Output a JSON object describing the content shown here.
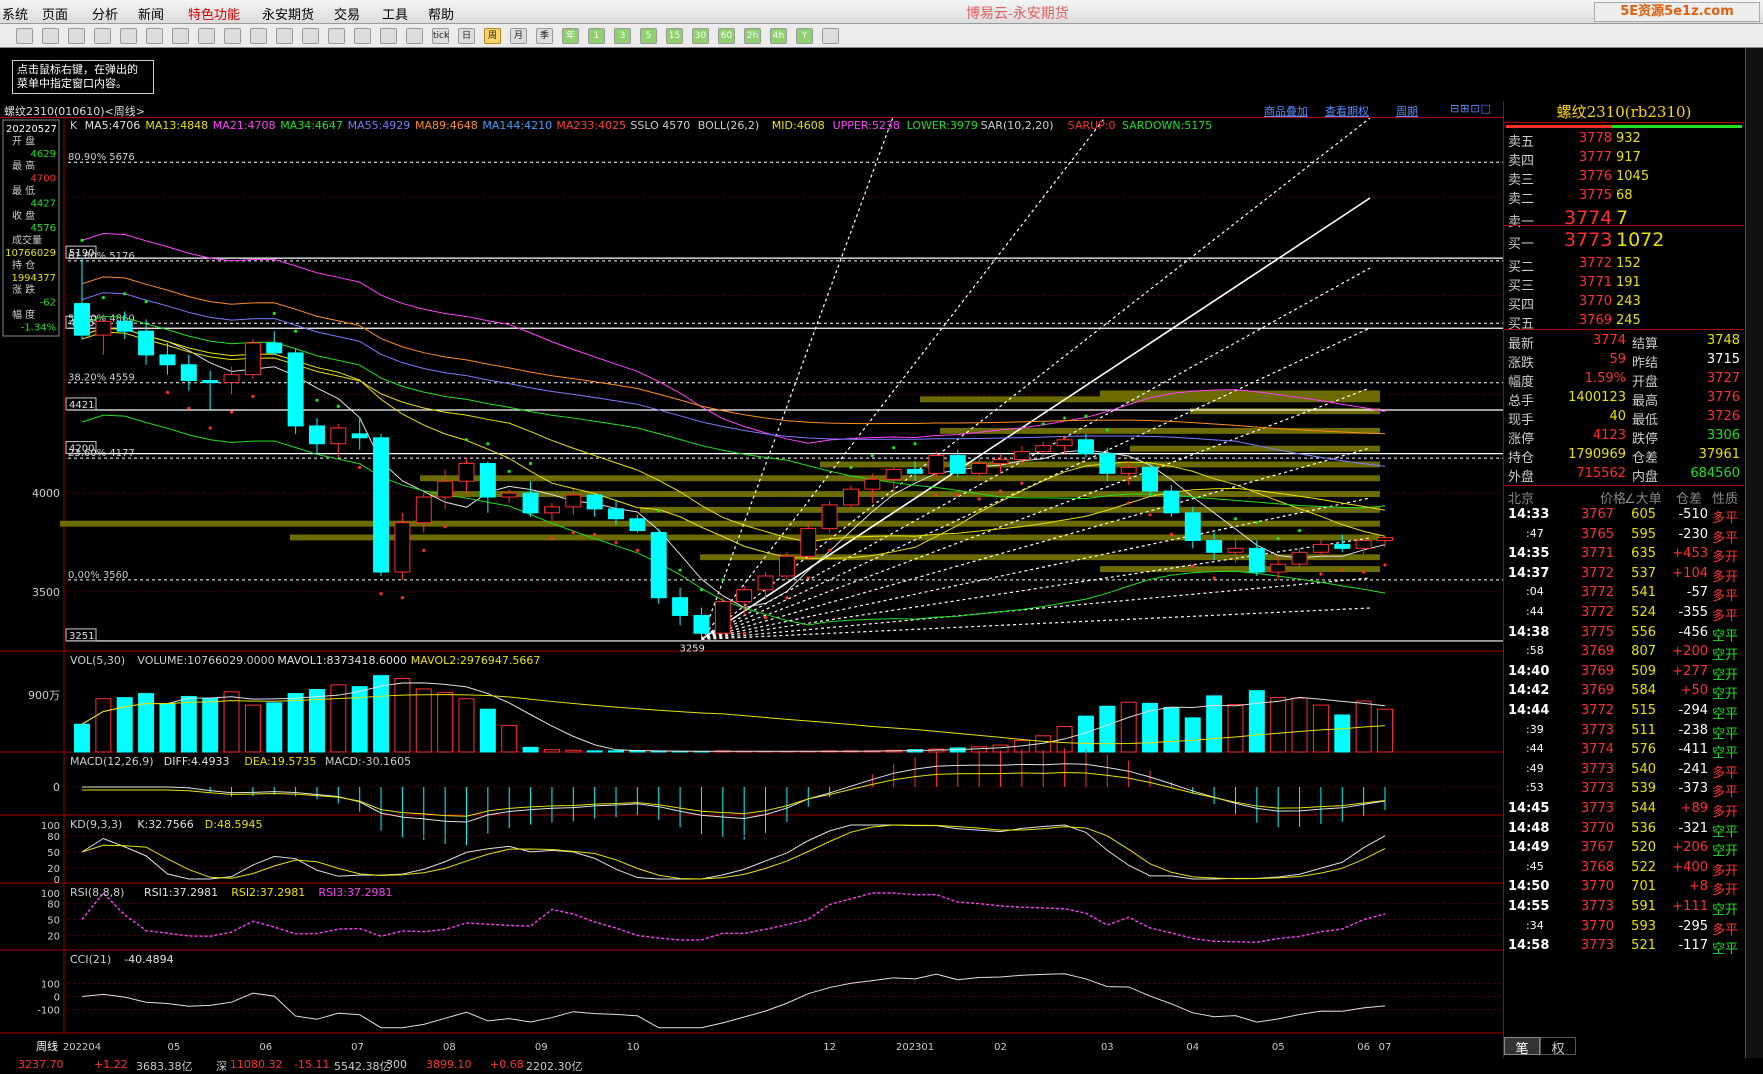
{
  "menu": [
    "系统",
    "页面",
    "分析",
    "新闻",
    "特色功能",
    "永安期货",
    "交易",
    "工具",
    "帮助"
  ],
  "app_title": "博易云-永安期货",
  "brand_text": "5E资源5e1z.com",
  "toolbar_tips": [
    "",
    "",
    "",
    "",
    "",
    "",
    "",
    "",
    "",
    "",
    "",
    "",
    "",
    "",
    "",
    "",
    "tick",
    "日",
    "周",
    "月",
    "季",
    "年",
    "1",
    "3",
    "5",
    "15",
    "30",
    "60",
    "2h",
    "4h",
    "Y",
    ""
  ],
  "hint": [
    "点击鼠标右键，在弹出的",
    "菜单中指定窗口内容。"
  ],
  "chart_header": {
    "symbol": "螺纹2310(010610)<周线>",
    "links": [
      "商品叠加",
      "查看期权",
      "周期"
    ]
  },
  "indicator_line": [
    {
      "t": "K",
      "c": "#cccccc"
    },
    {
      "t": "MA5:4706",
      "c": "#e0e0e0"
    },
    {
      "t": "MA13:4848",
      "c": "#e8e000"
    },
    {
      "t": "MA21:4708",
      "c": "#ff40ff"
    },
    {
      "t": "MA34:4647",
      "c": "#20e020"
    },
    {
      "t": "MA55:4929",
      "c": "#7b7bff"
    },
    {
      "t": "MA89:4648",
      "c": "#ff8c20"
    },
    {
      "t": "MA144:4210",
      "c": "#40a0ff"
    },
    {
      "t": "MA233:4025",
      "c": "#ff4040"
    },
    {
      "t": "SSLO 4570",
      "c": "#cccccc"
    },
    {
      "t": "BOLL(26,2)",
      "c": "#cccccc"
    },
    {
      "t": "MID:4608",
      "c": "#e8e000"
    },
    {
      "t": "UPPER:5238",
      "c": "#ff40ff"
    },
    {
      "t": "LOWER:3979",
      "c": "#20e020"
    },
    {
      "t": "SAR(10,2,20)",
      "c": "#cccccc"
    },
    {
      "t": "SARUP:0",
      "c": "#ff3030"
    },
    {
      "t": "SARDOWN:5175",
      "c": "#20e020"
    }
  ],
  "ohlc_box": {
    "date": "20220527",
    "open_label": "开 盘",
    "open": "4629",
    "high_label": "最 高",
    "high": "4700",
    "low_label": "最 低",
    "low": "4427",
    "close_label": "收 盘",
    "close": "4576",
    "vol_label": "成交量",
    "vol": "10766029",
    "oi_label": "持 仓",
    "oi": "1994377",
    "chg_label": "涨 跌",
    "chg": "-62",
    "pct_label": "幅 度",
    "pct": "-1.34%"
  },
  "price_axis": [
    "4000",
    "3500"
  ],
  "fib_labels": [
    "80.90% 5676",
    "61.80% 5176",
    "50.00% 4860",
    "38.20% 4559",
    "23.60% 4177",
    "0.00% 3560"
  ],
  "hline_labels": [
    "5190",
    "4835",
    "4421",
    "4200",
    "3251"
  ],
  "low_label": "3259",
  "vol_header": [
    {
      "t": "VOL(5,30)",
      "c": "#cccccc"
    },
    {
      "t": "VOLUME:10766029.0000",
      "c": "#cccccc"
    },
    {
      "t": "MAVOL1:8373418.6000",
      "c": "#e0e0e0"
    },
    {
      "t": "MAVOL2:2976947.5667",
      "c": "#e8e000"
    }
  ],
  "vol_axis": "900万",
  "macd_header": [
    {
      "t": "MACD(12,26,9)",
      "c": "#cccccc"
    },
    {
      "t": "DIFF:4.4933",
      "c": "#e0e0e0"
    },
    {
      "t": "DEA:19.5735",
      "c": "#e8e000"
    },
    {
      "t": "MACD:-30.1605",
      "c": "#cccccc"
    }
  ],
  "macd_axis": [
    "0"
  ],
  "kd_header": [
    {
      "t": "KD(9,3,3)",
      "c": "#cccccc"
    },
    {
      "t": "K:32.7566",
      "c": "#e0e0e0"
    },
    {
      "t": "D:48.5945",
      "c": "#e8e000"
    }
  ],
  "kd_axis": [
    "100",
    "80",
    "50",
    "20",
    "0"
  ],
  "rsi_header": [
    {
      "t": "RSI(8,8,8)",
      "c": "#cccccc"
    },
    {
      "t": "RSI1:37.2981",
      "c": "#e0e0e0"
    },
    {
      "t": "RSI2:37.2981",
      "c": "#e8e000"
    },
    {
      "t": "RSI3:37.2981",
      "c": "#ff40ff"
    }
  ],
  "rsi_axis": [
    "100",
    "80",
    "50",
    "20"
  ],
  "cci_header": [
    {
      "t": "CCI(21)",
      "c": "#cccccc"
    },
    {
      "t": "-40.4894",
      "c": "#e0e0e0"
    }
  ],
  "cci_axis": [
    "100",
    "0",
    "-100"
  ],
  "x_axis": {
    "period_label": "周线",
    "ticks": [
      "202204",
      "05",
      "06",
      "07",
      "08",
      "09",
      "10",
      "12",
      "202301",
      "02",
      "03",
      "04",
      "05",
      "06",
      "07"
    ]
  },
  "chart_data": {
    "type": "candlestick",
    "period": "weekly",
    "ma_visible": true,
    "y_range": [
      3200,
      5900
    ],
    "candles": [
      [
        4960,
        5190,
        4780,
        4800
      ],
      [
        4800,
        4900,
        4700,
        4870
      ],
      [
        4870,
        4920,
        4780,
        4820
      ],
      [
        4820,
        4880,
        4650,
        4700
      ],
      [
        4700,
        4760,
        4600,
        4650
      ],
      [
        4650,
        4700,
        4520,
        4570
      ],
      [
        4570,
        4620,
        4420,
        4560
      ],
      [
        4560,
        4640,
        4500,
        4600
      ],
      [
        4600,
        4780,
        4580,
        4760
      ],
      [
        4760,
        4820,
        4700,
        4710
      ],
      [
        4710,
        4730,
        4300,
        4340
      ],
      [
        4340,
        4380,
        4200,
        4250
      ],
      [
        4250,
        4350,
        4180,
        4330
      ],
      [
        4300,
        4380,
        4220,
        4280
      ],
      [
        4280,
        4300,
        3580,
        3600
      ],
      [
        3600,
        3900,
        3560,
        3850
      ],
      [
        3850,
        4000,
        3800,
        3980
      ],
      [
        3980,
        4120,
        3920,
        4060
      ],
      [
        4060,
        4180,
        4000,
        4150
      ],
      [
        4150,
        4160,
        3900,
        3980
      ],
      [
        3980,
        4020,
        3950,
        4000
      ],
      [
        4000,
        4060,
        3880,
        3900
      ],
      [
        3900,
        3950,
        3860,
        3930
      ],
      [
        3930,
        4020,
        3890,
        3990
      ],
      [
        3990,
        3980,
        3880,
        3920
      ],
      [
        3920,
        3960,
        3840,
        3870
      ],
      [
        3870,
        3890,
        3800,
        3810
      ],
      [
        3800,
        3820,
        3440,
        3470
      ],
      [
        3470,
        3520,
        3330,
        3380
      ],
      [
        3380,
        3420,
        3259,
        3290
      ],
      [
        3290,
        3470,
        3280,
        3450
      ],
      [
        3450,
        3530,
        3380,
        3510
      ],
      [
        3510,
        3600,
        3460,
        3580
      ],
      [
        3580,
        3700,
        3560,
        3680
      ],
      [
        3680,
        3850,
        3660,
        3820
      ],
      [
        3820,
        3960,
        3800,
        3940
      ],
      [
        3940,
        4040,
        3920,
        4020
      ],
      [
        4020,
        4100,
        3950,
        4070
      ],
      [
        4070,
        4140,
        4000,
        4120
      ],
      [
        4120,
        4160,
        4060,
        4100
      ],
      [
        4100,
        4210,
        4080,
        4190
      ],
      [
        4190,
        4220,
        4080,
        4100
      ],
      [
        4100,
        4180,
        4060,
        4150
      ],
      [
        4150,
        4200,
        4100,
        4170
      ],
      [
        4170,
        4240,
        4140,
        4210
      ],
      [
        4210,
        4260,
        4180,
        4240
      ],
      [
        4240,
        4290,
        4200,
        4270
      ],
      [
        4270,
        4300,
        4180,
        4200
      ],
      [
        4200,
        4230,
        4060,
        4100
      ],
      [
        4100,
        4160,
        4040,
        4130
      ],
      [
        4130,
        4150,
        3980,
        4010
      ],
      [
        4010,
        4040,
        3880,
        3900
      ],
      [
        3900,
        3930,
        3720,
        3760
      ],
      [
        3760,
        3800,
        3660,
        3700
      ],
      [
        3700,
        3780,
        3650,
        3720
      ],
      [
        3720,
        3760,
        3580,
        3600
      ],
      [
        3600,
        3680,
        3560,
        3640
      ],
      [
        3640,
        3720,
        3620,
        3700
      ],
      [
        3700,
        3760,
        3680,
        3740
      ],
      [
        3740,
        3790,
        3700,
        3720
      ],
      [
        3720,
        3770,
        3690,
        3760
      ],
      [
        3760,
        3778,
        3726,
        3774
      ]
    ],
    "volumes": [
      4.8,
      9.2,
      9.4,
      10.1,
      8.3,
      9.6,
      9.3,
      10.4,
      8.1,
      8.5,
      10.1,
      10.8,
      11.6,
      11.3,
      13.2,
      12.7,
      10.9,
      10.3,
      9.2,
      7.4,
      4.6,
      0.8,
      0.4,
      0.3,
      0.2,
      0.2,
      0.2,
      0.1,
      0.1,
      0.1,
      0.2,
      0.1,
      0.1,
      0.1,
      0.1,
      0.2,
      0.2,
      0.2,
      0.3,
      0.4,
      0.5,
      0.7,
      0.9,
      1.2,
      2.0,
      2.8,
      4.4,
      6.2,
      7.9,
      8.6,
      8.4,
      7.7,
      5.9,
      9.7,
      8.2,
      10.6,
      9.4,
      9.3,
      8.1,
      6.4,
      8.8,
      7.4
    ],
    "volume_unit": "万手/10",
    "macd_y_range": [
      -80,
      80
    ],
    "kd_y_range": [
      0,
      100
    ],
    "rsi_y_range": [
      0,
      100
    ],
    "cci_y_range": [
      -250,
      250
    ]
  },
  "rpanel": {
    "title": "螺纹2310(rb2310)",
    "asks": [
      [
        "卖五",
        "3778",
        "932"
      ],
      [
        "卖四",
        "3777",
        "917"
      ],
      [
        "卖三",
        "3776",
        "1045"
      ],
      [
        "卖二",
        "3775",
        "68"
      ],
      [
        "卖一",
        "3774",
        "7"
      ]
    ],
    "bids": [
      [
        "买一",
        "3773",
        "1072"
      ],
      [
        "买二",
        "3772",
        "152"
      ],
      [
        "买三",
        "3771",
        "191"
      ],
      [
        "买四",
        "3770",
        "243"
      ],
      [
        "买五",
        "3769",
        "245"
      ]
    ],
    "stats": [
      [
        "最新",
        "3774",
        "结算",
        "3748"
      ],
      [
        "涨跌",
        "59",
        "昨结",
        "3715"
      ],
      [
        "幅度",
        "1.59%",
        "开盘",
        "3727"
      ],
      [
        "总手",
        "1400123",
        "最高",
        "3776"
      ],
      [
        "现手",
        "40",
        "最低",
        "3726"
      ],
      [
        "涨停",
        "4123",
        "跌停",
        "3306"
      ],
      [
        "持仓",
        "1790969",
        "仓差",
        "37961"
      ],
      [
        "外盘",
        "715562",
        "内盘",
        "684560"
      ]
    ],
    "tick_head": [
      "北京",
      "价格",
      "∠大单",
      "仓差",
      "性质"
    ],
    "ticks": [
      [
        "14:33",
        "3767",
        "605",
        "-510",
        "多平"
      ],
      [
        ":47",
        "3765",
        "595",
        "-230",
        "多平"
      ],
      [
        "14:35",
        "3771",
        "635",
        "+453",
        "多开"
      ],
      [
        "14:37",
        "3772",
        "537",
        "+104",
        "多开"
      ],
      [
        ":04",
        "3772",
        "541",
        "-57",
        "多平"
      ],
      [
        ":44",
        "3772",
        "524",
        "-355",
        "多平"
      ],
      [
        "14:38",
        "3775",
        "556",
        "-456",
        "空平"
      ],
      [
        ":58",
        "3769",
        "807",
        "+200",
        "空开"
      ],
      [
        "14:40",
        "3769",
        "509",
        "+277",
        "空开"
      ],
      [
        "14:42",
        "3769",
        "584",
        "+50",
        "空开"
      ],
      [
        "14:44",
        "3772",
        "515",
        "-294",
        "空平"
      ],
      [
        ":39",
        "3773",
        "511",
        "-238",
        "空平"
      ],
      [
        ":44",
        "3774",
        "576",
        "-411",
        "空平"
      ],
      [
        ":49",
        "3773",
        "540",
        "-241",
        "多平"
      ],
      [
        ":53",
        "3773",
        "539",
        "-373",
        "多平"
      ],
      [
        "14:45",
        "3773",
        "544",
        "+89",
        "多开"
      ],
      [
        "14:48",
        "3770",
        "536",
        "-321",
        "空平"
      ],
      [
        "14:49",
        "3767",
        "520",
        "+206",
        "空开"
      ],
      [
        ":45",
        "3768",
        "522",
        "+400",
        "多开"
      ],
      [
        "14:50",
        "3770",
        "701",
        "+8",
        "多开"
      ],
      [
        "14:55",
        "3773",
        "591",
        "+111",
        "空开"
      ],
      [
        ":34",
        "3770",
        "593",
        "-295",
        "多平"
      ],
      [
        "14:58",
        "3773",
        "521",
        "-117",
        "空平"
      ]
    ],
    "bottom_tabs": [
      "笔",
      "权"
    ]
  },
  "status_bar": [
    "3237.70",
    "+1.22",
    "3683.38亿",
    "深",
    "11080.32",
    "-15.11",
    "5542.38亿",
    "300",
    "3899.10",
    "+0.68",
    "2202.30亿"
  ],
  "colors": {
    "up": "#ff3030",
    "down": "#00ffff",
    "grid": "#600000",
    "fib_band": "#6b6b00"
  }
}
